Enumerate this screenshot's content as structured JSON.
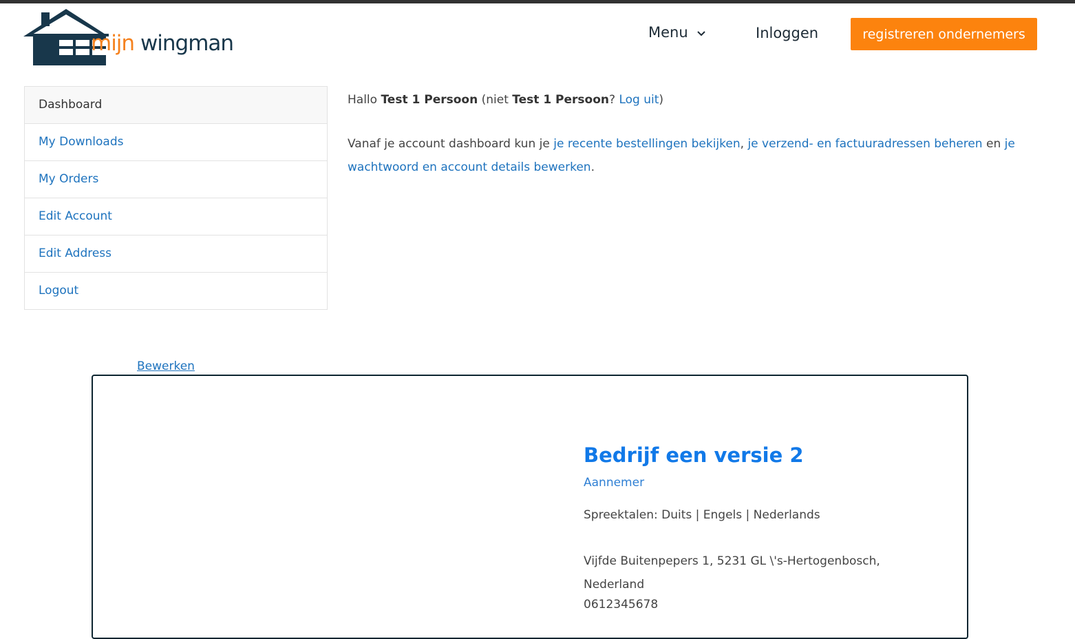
{
  "header": {
    "logo": {
      "text_prefix": "mijn",
      "text_suffix": "wingman",
      "accent_color": "#f5821f",
      "brand_color": "#18374b"
    },
    "nav": {
      "menu_label": "Menu",
      "login_label": "Inloggen",
      "register_label": "registreren ondernemers"
    }
  },
  "sidebar": {
    "items": [
      {
        "label": "Dashboard",
        "active": true
      },
      {
        "label": "My Downloads",
        "active": false
      },
      {
        "label": "My Orders",
        "active": false
      },
      {
        "label": "Edit Account",
        "active": false
      },
      {
        "label": "Edit Address",
        "active": false
      },
      {
        "label": "Logout",
        "active": false
      }
    ]
  },
  "main": {
    "greeting": {
      "hello": "Hallo",
      "user_name": "Test 1 Persoon",
      "not_prefix": "(niet",
      "not_user": "Test 1 Persoon",
      "question": "?",
      "logout_link": "Log uit",
      "close_paren": ")"
    },
    "intro": {
      "text_before": "Vanaf je account dashboard kun je",
      "link_orders": "je recente bestellingen bekijken",
      "comma": ",",
      "link_addresses": "je verzend- en factuuradressen beheren",
      "and": "en",
      "link_account": "je wachtwoord en account details bewerken",
      "period": "."
    }
  },
  "company": {
    "edit_link": "Bewerken",
    "name": "Bedrijf een versie 2",
    "role": "Aannemer",
    "languages": "Spreektalen: Duits | Engels | Nederlands",
    "address_line": "Vijfde Buitenpepers 1, 5231 GL \\'s-Hertogenbosch,",
    "country": "Nederland",
    "phone": "0612345678"
  },
  "colors": {
    "accent_orange": "#fc830e",
    "link_blue": "#1e73be",
    "title_blue": "#1179e8",
    "card_border": "#0d2530"
  }
}
